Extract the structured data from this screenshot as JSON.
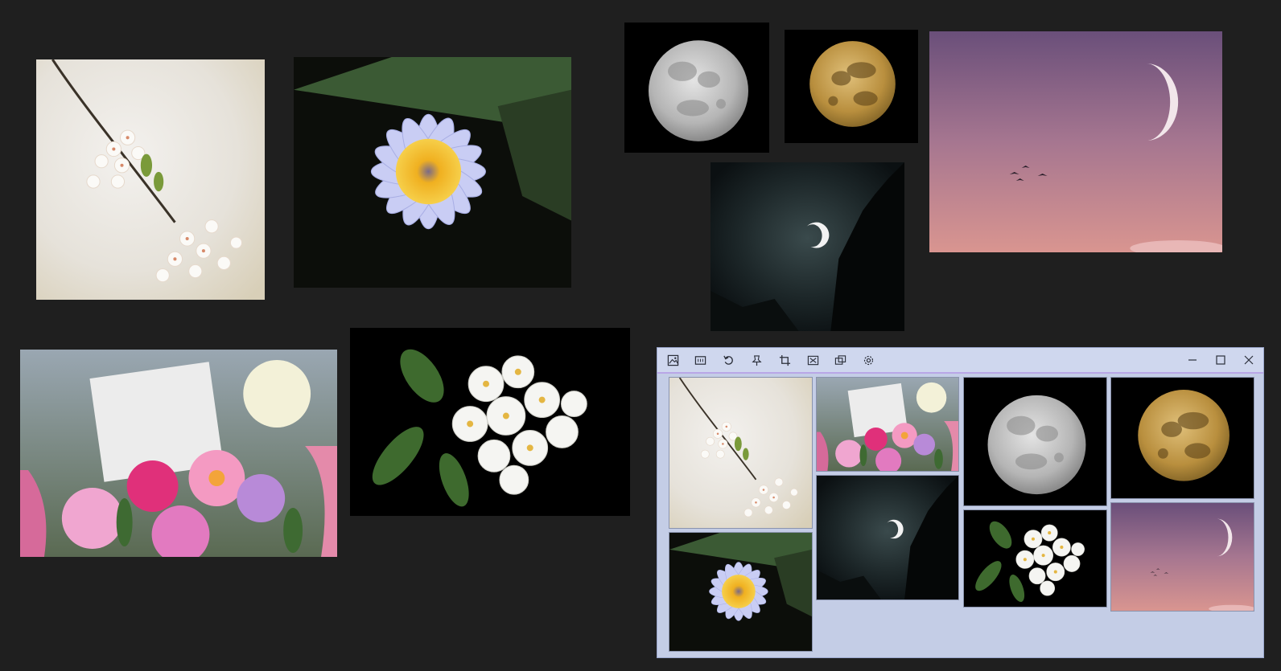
{
  "toolbar": {
    "icons": [
      "image-icon",
      "grid-icon",
      "undo-icon",
      "pin-icon",
      "crop-icon",
      "shuffle-icon",
      "duplicate-icon",
      "settings-icon"
    ]
  },
  "window_controls": [
    "minimize-icon",
    "maximize-icon",
    "close-icon"
  ],
  "colors": {
    "background": "#1f1f1f",
    "window_bg": "#c4cde6",
    "toolbar_bg": "#cfd7ee",
    "toolbar_border": "#b9a6e6"
  },
  "photos": [
    "cherry-blossom",
    "water-lily",
    "full-moon-gray",
    "full-moon-gold",
    "dusk-sky-crescent",
    "night-crescent-forest",
    "flower-bouquet",
    "white-blossoms"
  ]
}
